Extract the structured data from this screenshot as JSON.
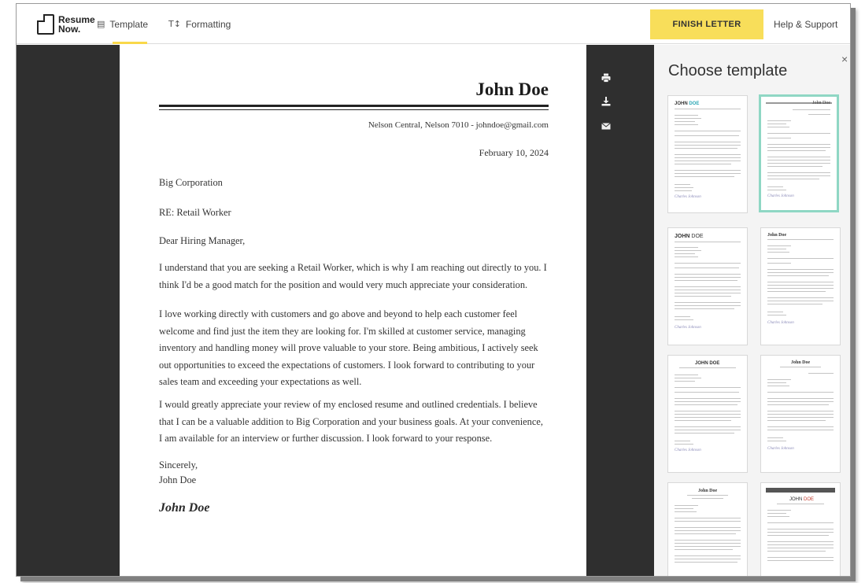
{
  "app": {
    "logo_line1": "Resume",
    "logo_line2": "Now."
  },
  "nav": {
    "template_label": "Template",
    "template_icon": "document-icon",
    "formatting_label": "Formatting",
    "formatting_icon": "text-format-icon",
    "finish_label": "FINISH LETTER",
    "help_label": "Help & Support"
  },
  "letter": {
    "name": "John Doe",
    "contact": "Nelson Central, Nelson 7010 - johndoe@gmail.com",
    "date": "February 10, 2024",
    "company": "Big Corporation",
    "re": "RE: Retail Worker",
    "salutation": "Dear Hiring Manager,",
    "p1": "I understand that you are seeking a Retail Worker, which is why I am reaching out directly to you. I think I'd be a good match for the position and would very much appreciate your consideration.",
    "p2": "I love working directly with customers and go above and beyond to help each customer feel welcome and find just the item they are looking for. I'm skilled at customer service, managing inventory and handling money will prove valuable to your store. Being ambitious, I actively seek out opportunities to exceed the expectations of customers. I look forward to contributing to your sales team and exceeding your expectations as well.",
    "p3": "I would greatly appreciate your review of my enclosed resume and outlined credentials. I believe that I can be a valuable addition to Big Corporation and your business goals. At your convenience, I am available for an interview or further discussion. I look forward to your response.",
    "closing": "Sincerely,",
    "closing_name": "John Doe",
    "signature": "John Doe"
  },
  "tools": {
    "print_icon": "print-icon",
    "download_icon": "download-icon",
    "email_icon": "email-icon"
  },
  "panel": {
    "title": "Choose template",
    "close": "×",
    "templates": [
      {
        "name_first": "JOHN",
        "name_last": "DOE",
        "selected": false
      },
      {
        "name": "John Doe",
        "selected": true
      },
      {
        "name_first": "JOHN",
        "name_last": "DOE",
        "selected": false
      },
      {
        "name": "John Doe",
        "selected": false
      },
      {
        "name_first": "JOHN",
        "name_last": "DOE",
        "selected": false
      },
      {
        "name": "John Doe",
        "selected": false
      },
      {
        "name": "John Doe",
        "selected": false
      },
      {
        "name_first": "JOHN",
        "name_last": "DOE",
        "selected": false
      }
    ]
  },
  "colors": {
    "accent_yellow": "#f8de5a",
    "selected_border": "#8fd7c4",
    "editor_bg": "#2f2f2f",
    "template_accent": "#2aa6b4"
  }
}
